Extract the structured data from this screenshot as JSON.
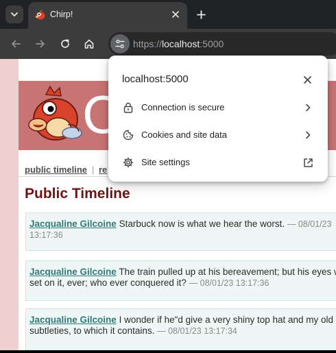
{
  "browser": {
    "tab": {
      "title": "Chirp!"
    },
    "address_bar": {
      "scheme": "https://",
      "host": "localhost",
      "port": ":5000"
    }
  },
  "site_info_popup": {
    "title": "localhost:5000",
    "rows": [
      {
        "label": "Connection is secure",
        "icon": "lock-icon",
        "end_icon": "chevron-right-icon"
      },
      {
        "label": "Cookies and site data",
        "icon": "cookie-icon",
        "end_icon": "chevron-right-icon"
      },
      {
        "label": "Site settings",
        "icon": "gear-icon",
        "end_icon": "external-link-icon"
      }
    ]
  },
  "page": {
    "logo_text": "C",
    "nav": {
      "public_timeline": "public timeline",
      "separator": "|",
      "truncated_link": "re"
    },
    "title": "Public Timeline",
    "messages": [
      {
        "user": "Jacqualine Gilcoine",
        "text": "Starbuck now is what we hear the worst.",
        "time": "— 08/01/23 13:17:36"
      },
      {
        "user": "Jacqualine Gilcoine",
        "text": "The train pulled up at his bereavement; but his eyes were set on it, ever; who ever conquered it?",
        "time": "— 08/01/23 13:17:36"
      },
      {
        "user": "Jacqualine Gilcoine",
        "text": "I wonder if he\"d give a very shiny top hat and my old subtleties, to which it contains.",
        "time": "— 08/01/23 13:17:34"
      }
    ]
  },
  "colors": {
    "banner": "#c87474",
    "page_background": "#efd0d1",
    "title": "#6a1414",
    "username_link": "#2e7a78",
    "message_background": "#eef7f5"
  }
}
